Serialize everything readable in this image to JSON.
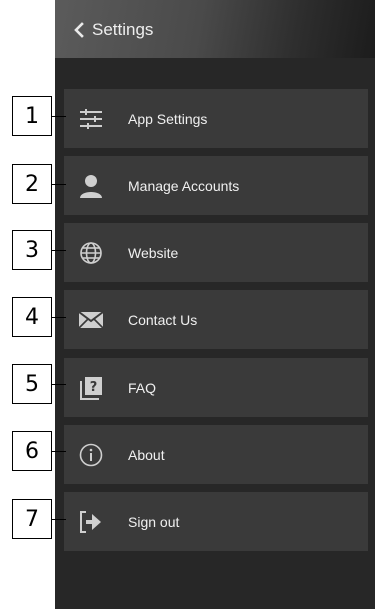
{
  "header": {
    "title": "Settings",
    "back_icon": "chevron-left-icon"
  },
  "menu": [
    {
      "label": "App Settings",
      "icon": "sliders-icon"
    },
    {
      "label": "Manage Accounts",
      "icon": "user-icon"
    },
    {
      "label": "Website",
      "icon": "globe-icon"
    },
    {
      "label": "Contact Us",
      "icon": "envelope-icon"
    },
    {
      "label": "FAQ",
      "icon": "faq-icon"
    },
    {
      "label": "About",
      "icon": "info-icon"
    },
    {
      "label": "Sign out",
      "icon": "sign-out-icon"
    }
  ],
  "callouts": [
    "1",
    "2",
    "3",
    "4",
    "5",
    "6",
    "7"
  ],
  "colors": {
    "background": "#272727",
    "item": "#3a3a3a",
    "text": "#f0f0f0"
  }
}
